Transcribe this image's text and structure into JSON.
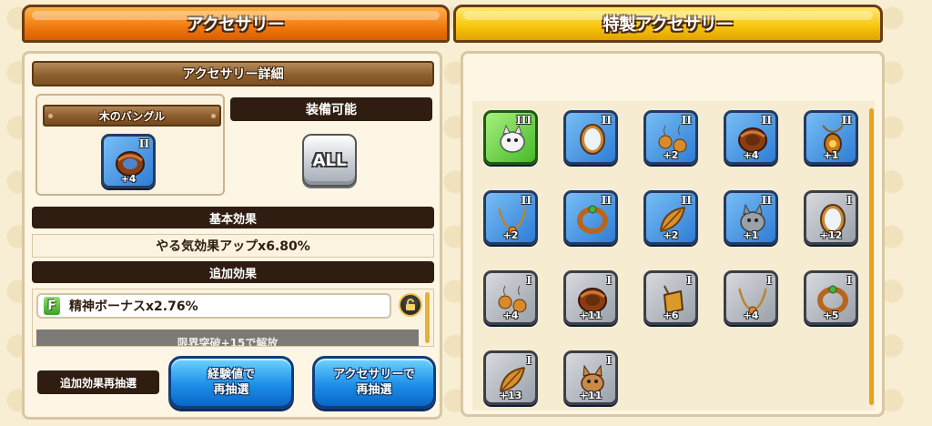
{
  "tabs": {
    "accessory": "アクセサリー",
    "special_accessory": "特製アクセサリー"
  },
  "detail": {
    "header": "アクセサリー詳細",
    "item_name": "木のバングル",
    "item_grade": "II",
    "item_plus": "+4",
    "equip_header": "装備可能",
    "equip_all": "ALL"
  },
  "base_effect": {
    "label": "基本効果",
    "value": "やる気効果アップx6.80%"
  },
  "extra_effect": {
    "label": "追加効果",
    "rank": "F",
    "value": "精神ボーナスx2.76%",
    "locked_text": "限界突破+15で解放"
  },
  "reroll": {
    "label": "追加効果再抽選",
    "exp_button": [
      "経験値で",
      "再抽選"
    ],
    "acc_button": [
      "アクセサリーで",
      "再抽選"
    ]
  },
  "accessories": [
    {
      "grade": "III",
      "plus": "",
      "bg": "green",
      "icon": "wolf-pup-icon"
    },
    {
      "grade": "II",
      "plus": "",
      "bg": "blue",
      "icon": "mirror-icon"
    },
    {
      "grade": "II",
      "plus": "+2",
      "bg": "blue",
      "icon": "earrings-icon"
    },
    {
      "grade": "II",
      "plus": "+4",
      "bg": "blue",
      "icon": "bangle-icon"
    },
    {
      "grade": "II",
      "plus": "+1",
      "bg": "blue",
      "icon": "pendant-icon"
    },
    {
      "grade": "II",
      "plus": "+2",
      "bg": "blue",
      "icon": "necklace-icon"
    },
    {
      "grade": "II",
      "plus": "",
      "bg": "blue",
      "icon": "ring-icon"
    },
    {
      "grade": "II",
      "plus": "+2",
      "bg": "blue",
      "icon": "leaf-icon"
    },
    {
      "grade": "II",
      "plus": "+1",
      "bg": "blue",
      "icon": "wolf-icon"
    },
    {
      "grade": "I",
      "plus": "+12",
      "bg": "gray",
      "icon": "mirror-icon"
    },
    {
      "grade": "I",
      "plus": "+4",
      "bg": "gray",
      "icon": "earrings-icon"
    },
    {
      "grade": "I",
      "plus": "+11",
      "bg": "gray",
      "icon": "bangle-icon"
    },
    {
      "grade": "I",
      "plus": "+6",
      "bg": "gray",
      "icon": "amulet-icon"
    },
    {
      "grade": "I",
      "plus": "+4",
      "bg": "gray",
      "icon": "necklace-icon"
    },
    {
      "grade": "I",
      "plus": "+5",
      "bg": "gray",
      "icon": "ring-icon"
    },
    {
      "grade": "I",
      "plus": "+13",
      "bg": "gray",
      "icon": "leaf-icon"
    },
    {
      "grade": "I",
      "plus": "+11",
      "bg": "gray",
      "icon": "fox-icon"
    }
  ]
}
